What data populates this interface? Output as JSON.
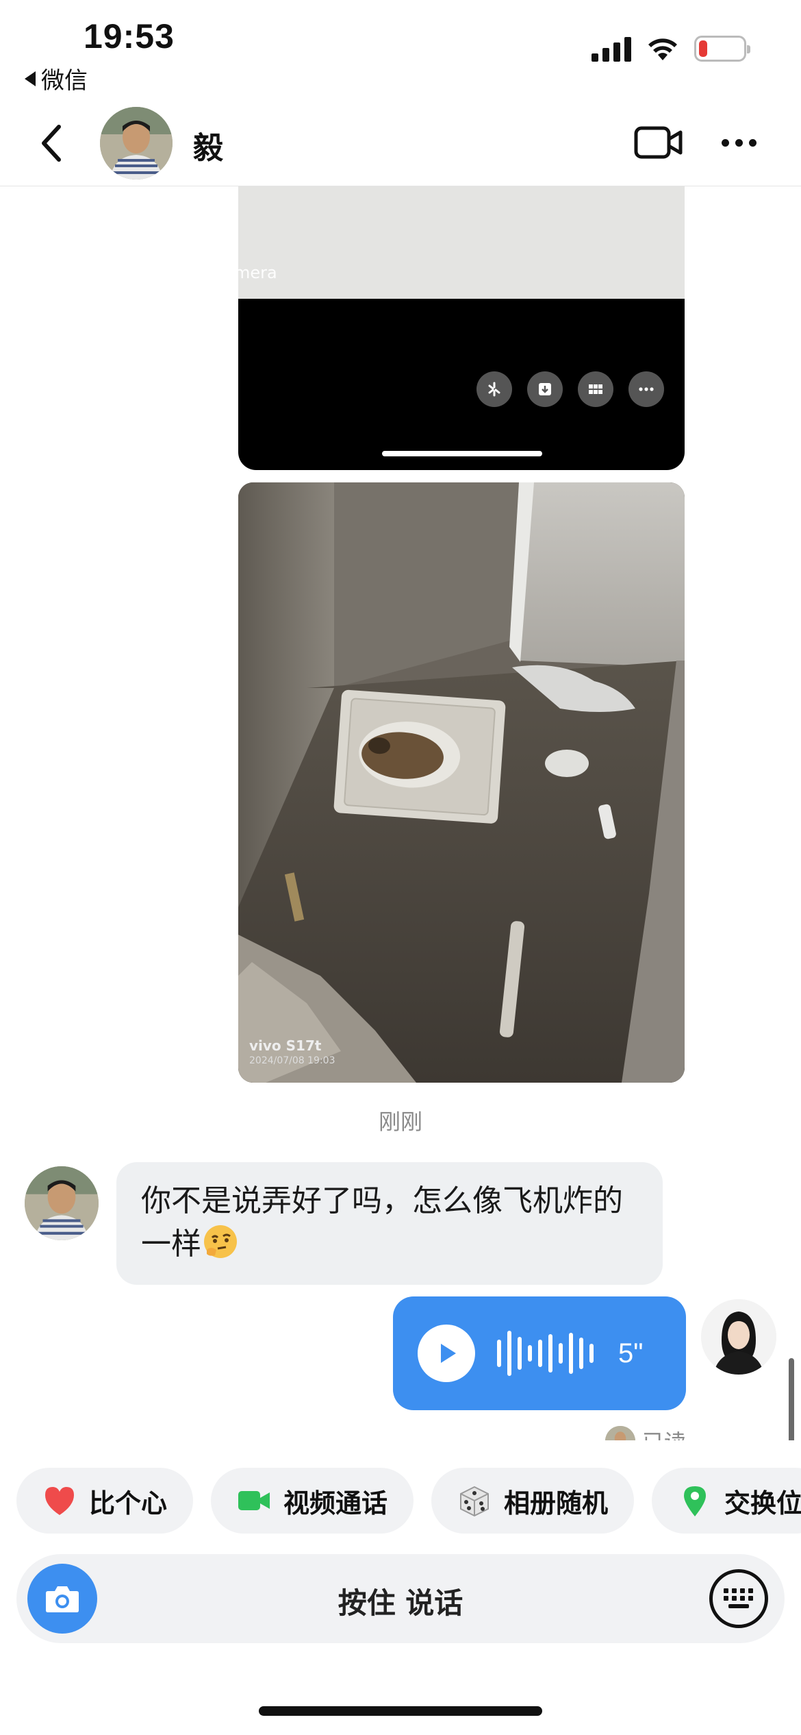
{
  "status_bar": {
    "time": "19:53",
    "back_app": "微信",
    "battery_level_percent": 10
  },
  "header": {
    "contact_name": "毅",
    "icons": [
      "back-arrow-icon",
      "video-camera-icon",
      "more-dots-icon"
    ]
  },
  "messages": {
    "image_1": {
      "overlay_text": "mera",
      "toolbar_icons": [
        "sparkle-icon",
        "download-icon",
        "grid-icon",
        "more-icon"
      ]
    },
    "image_2": {
      "caption_device": "vivo S17t",
      "caption_date": "2024/07/08 19:03"
    },
    "timestamp": "刚刚",
    "incoming_text": "你不是说弄好了吗，怎么像飞机炸的一样",
    "voice": {
      "duration": "5\""
    },
    "read_status": "已读"
  },
  "quick_actions": [
    {
      "label": "比个心",
      "icon": "heart-icon",
      "color": "#ef4b4b"
    },
    {
      "label": "视频通话",
      "icon": "video-icon",
      "color": "#2fc15a"
    },
    {
      "label": "相册随机",
      "icon": "dice-icon",
      "color": "#8a8a8a"
    },
    {
      "label": "交换位",
      "icon": "location-pin-icon",
      "color": "#2fc15a"
    }
  ],
  "input_bar": {
    "hold_to_talk": "按住 说话"
  },
  "colors": {
    "accent_blue": "#3d8ff0",
    "bubble_gray": "#eef0f2"
  }
}
